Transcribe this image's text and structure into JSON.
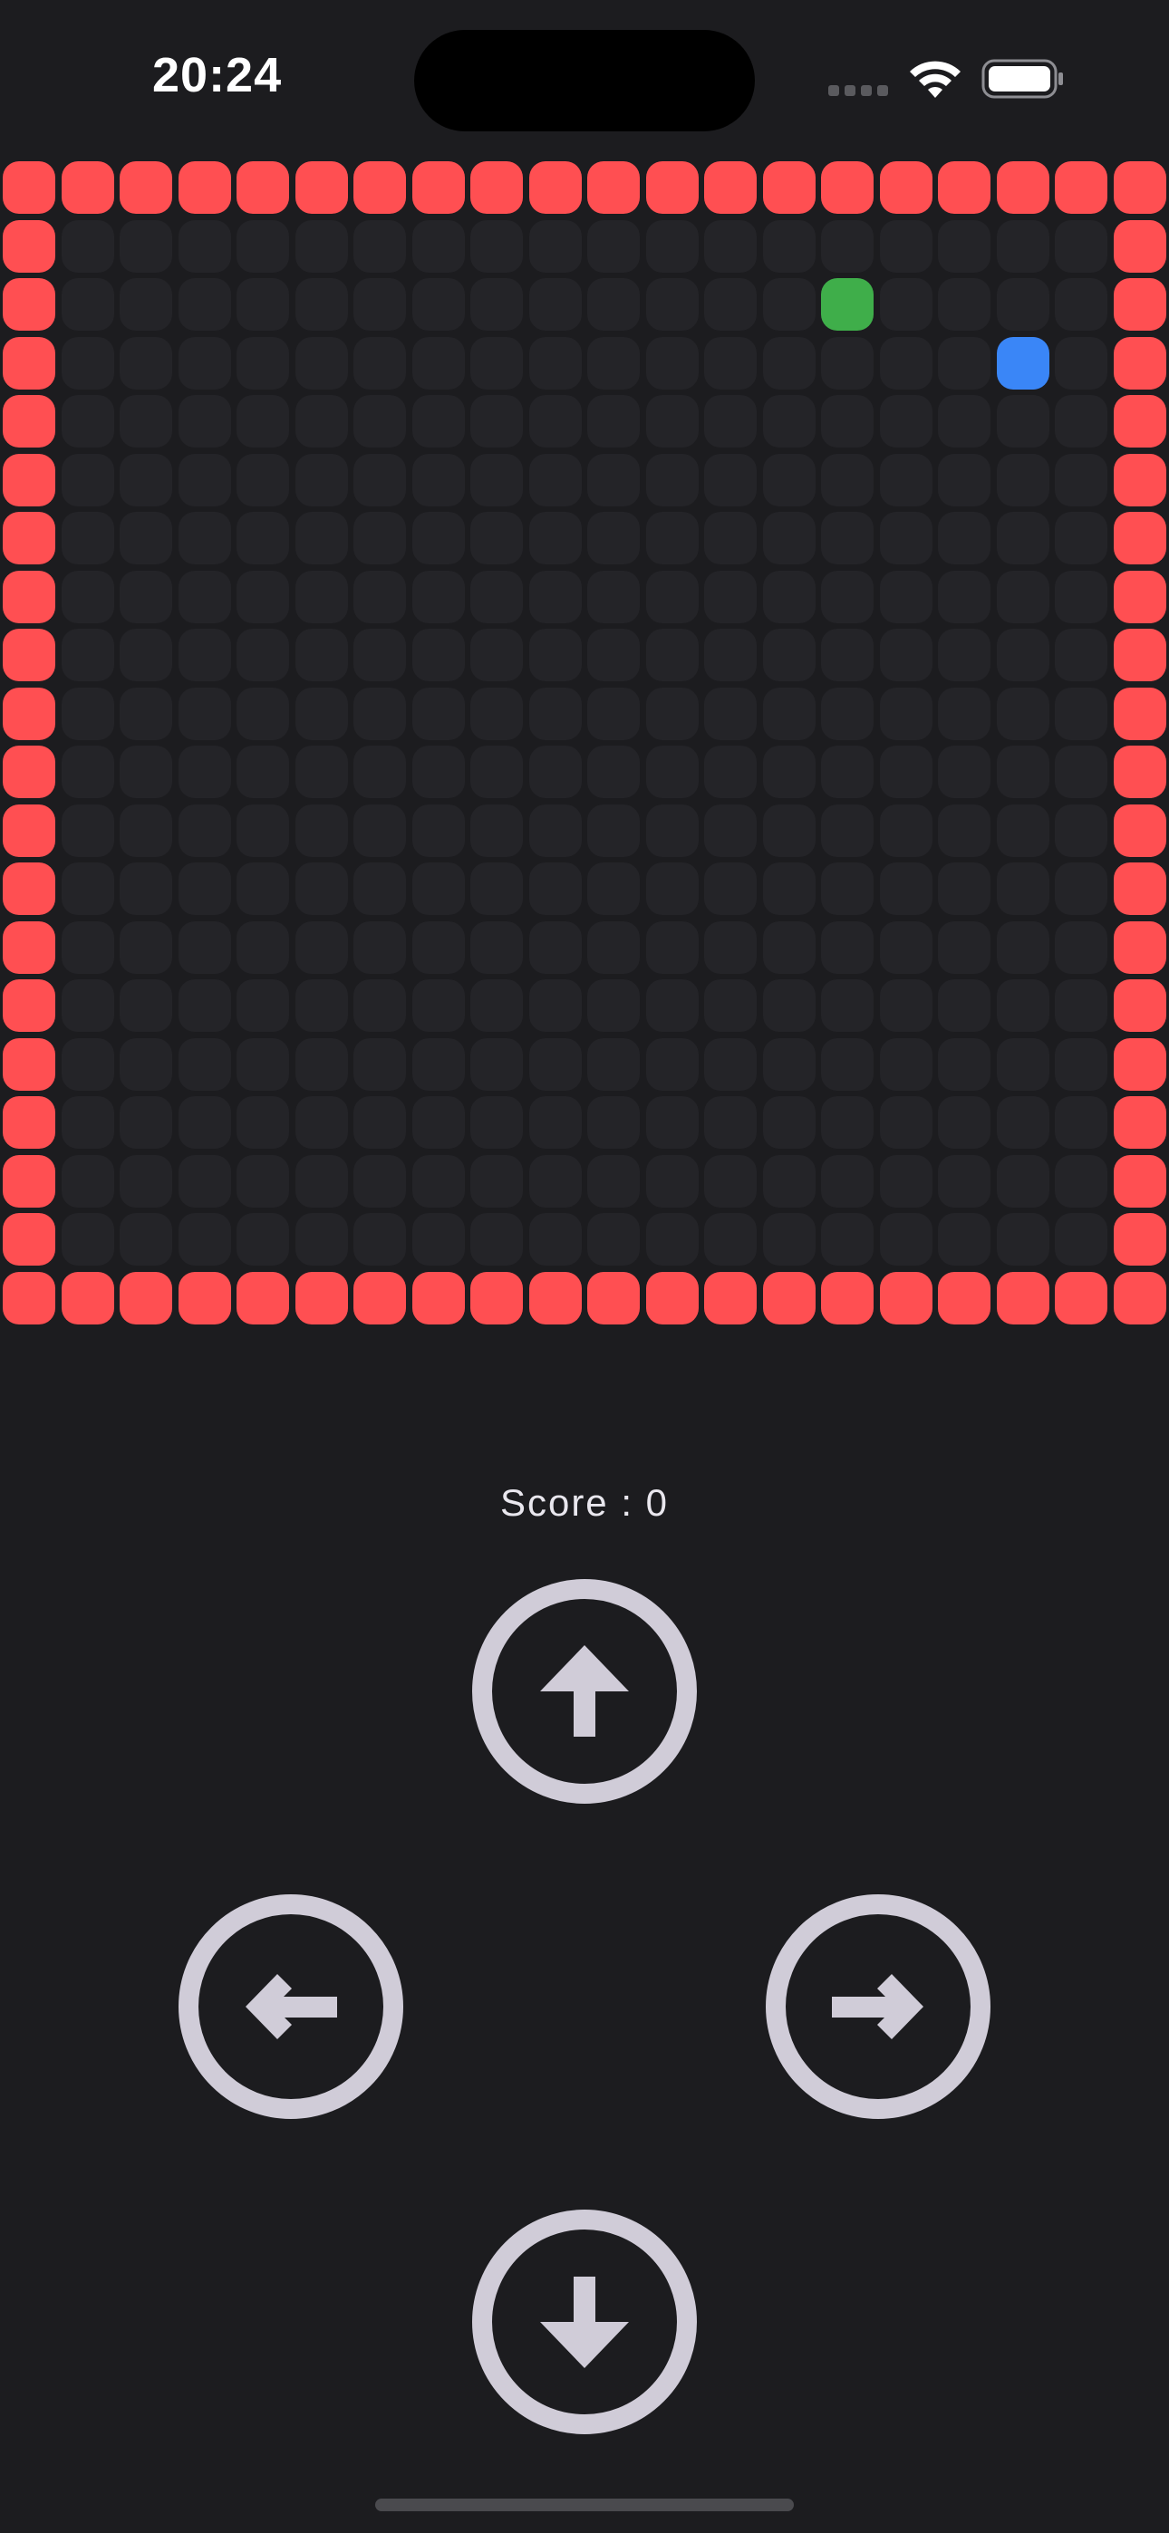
{
  "status_bar": {
    "time": "20:24",
    "icons": [
      "cellular-signal-icon",
      "wifi-icon",
      "battery-icon"
    ]
  },
  "game": {
    "grid_cols": 20,
    "grid_rows": 20,
    "wall_color": "#ff4f52",
    "empty_color": "#242428",
    "food": {
      "col": 14,
      "row": 2,
      "color": "#3fae4a"
    },
    "snake": {
      "cells": [
        {
          "col": 17,
          "row": 3
        }
      ],
      "color": "#3a86f7"
    }
  },
  "score": {
    "label": "Score : 0"
  },
  "controls": {
    "up": "arrow-up-icon",
    "left": "arrow-left-icon",
    "right": "arrow-right-icon",
    "down": "arrow-down-icon",
    "color": "#d0ccd8"
  }
}
